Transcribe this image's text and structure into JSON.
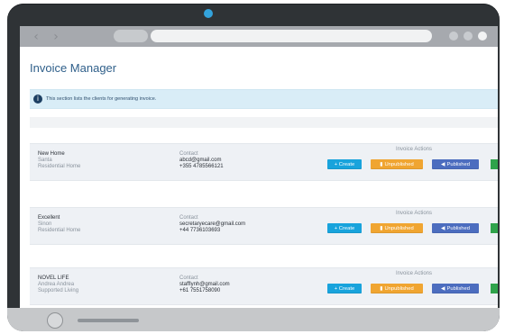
{
  "app": {
    "title": "Invoice Manager"
  },
  "browser": {
    "back_icon": "chevron-left-icon",
    "forward_icon": "chevron-right-icon"
  },
  "info_banner": {
    "icon": "info-icon",
    "text": "This section lists the clients for generating invoice."
  },
  "clients": [
    {
      "name": "New Home",
      "contact_person": "Santa",
      "type": "Residential Home",
      "contact_label": "Contact",
      "email": "abcd@gmail.com",
      "phone": "+355 4785566121",
      "actions_label": "Invoice Actions",
      "create_label": "+ Create",
      "unpublished_label": "Unpublished",
      "published_label": "Published"
    },
    {
      "name": "Excellent",
      "contact_person": "Sinon",
      "type": "Residential Home",
      "contact_label": "Contact",
      "email": "secretaryecare@gmail.com",
      "phone": "+44 7736103693",
      "actions_label": "Invoice Actions",
      "create_label": "+ Create",
      "unpublished_label": "Unpublished",
      "published_label": "Published"
    },
    {
      "name": "NOVEL LIFE",
      "contact_person": "Andrea Andrea",
      "type": "Supported Living",
      "contact_label": "Contact",
      "email": "stafflynh@gmail.com",
      "phone": "+61 7551758090",
      "actions_label": "Invoice Actions",
      "create_label": "+ Create",
      "unpublished_label": "Unpublished",
      "published_label": "Published"
    }
  ],
  "colors": {
    "create": "#18a3dc",
    "unpublished": "#f0a531",
    "published": "#4c6dbf",
    "extra_action": "#2fa34b",
    "title": "#2f5f8a",
    "banner": "#d9edf7"
  },
  "icons": {
    "unpublished": "file-icon",
    "published": "speaker-icon"
  }
}
